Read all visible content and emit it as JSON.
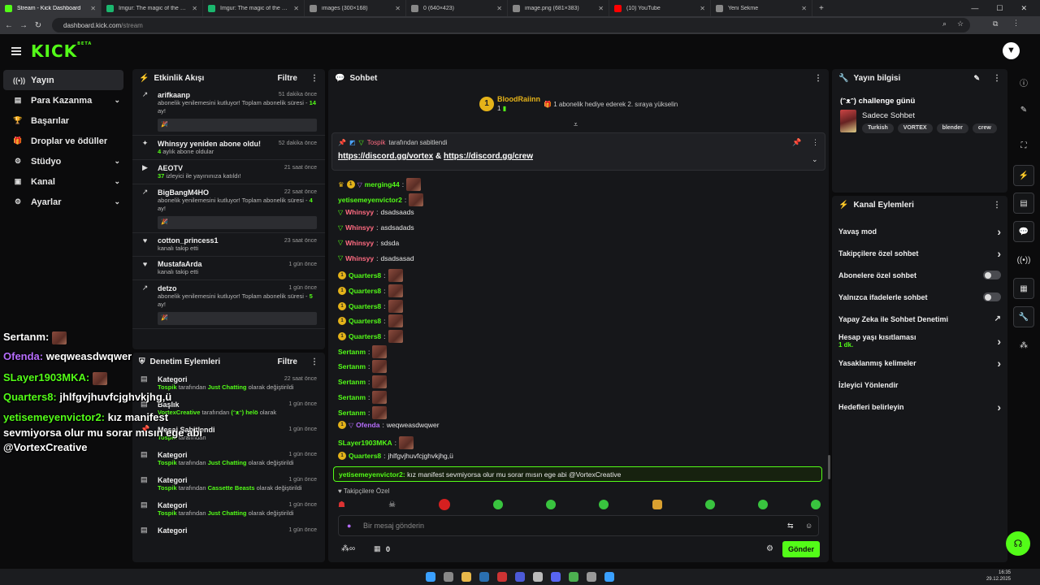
{
  "browser": {
    "tabs": [
      {
        "title": "Stream - Kick Dashboard",
        "color": "#53fc18",
        "active": true
      },
      {
        "title": "Imgur: The magic of the Interne",
        "color": "#1bb76e"
      },
      {
        "title": "Imgur: The magic of the Interne",
        "color": "#1bb76e"
      },
      {
        "title": "images (300×168)",
        "color": "#888888"
      },
      {
        "title": "0 (640×423)",
        "color": "#888888"
      },
      {
        "title": "image.png (681×383)",
        "color": "#888888"
      },
      {
        "title": "(10) YouTube",
        "color": "#ff0000"
      },
      {
        "title": "Yeni Sekme",
        "color": "#888888"
      }
    ],
    "url_host": "dashboard.kick.com",
    "url_path": "/stream"
  },
  "brand": {
    "logo": "KICK",
    "beta": "BETA"
  },
  "sidebar": {
    "items": [
      {
        "label": "Yayın",
        "icon": "broadcast-icon",
        "glyph": "((•))",
        "active": true
      },
      {
        "label": "Para Kazanma",
        "icon": "money-icon",
        "glyph": "▤",
        "chevron": true
      },
      {
        "label": "Başarılar",
        "icon": "trophy-icon",
        "glyph": "🏆"
      },
      {
        "label": "Droplar ve ödüller",
        "icon": "gift-icon",
        "glyph": "🎁"
      },
      {
        "label": "Stüdyo",
        "icon": "gear-icon",
        "glyph": "⚙",
        "chevron": true
      },
      {
        "label": "Kanal",
        "icon": "channel-icon",
        "glyph": "▣",
        "chevron": true
      },
      {
        "label": "Ayarlar",
        "icon": "settings-icon",
        "glyph": "⚙",
        "chevron": true
      }
    ]
  },
  "activity": {
    "title": "Etkinlik Akışı",
    "filter": "Filtre",
    "items": [
      {
        "name": "arifkaanp",
        "time": "51 dakika önce",
        "icon": "resub-icon",
        "glyph": "↗",
        "desc": "abonelik yenilemesini kutluyor! Toplam abonelik süresi - ",
        "bold": "14",
        "tail": " ay!",
        "quote": true
      },
      {
        "name": "Whinsyy yeniden abone oldu!",
        "time": "52 dakika önce",
        "icon": "star-icon",
        "glyph": "✦",
        "desc": "",
        "bold": "4",
        "tail": " aylık abone oldular"
      },
      {
        "name": "AEOTV",
        "time": "21 saat önce",
        "icon": "host-icon",
        "glyph": "▶",
        "desc": "",
        "bold": "37",
        "tail": " izleyici ile yayınınıza katıldı!"
      },
      {
        "name": "BigBangM4HO",
        "time": "22 saat önce",
        "icon": "resub-icon",
        "glyph": "↗",
        "desc": "abonelik yenilemesini kutluyor! Toplam abonelik süresi - ",
        "bold": "4",
        "tail": " ay!",
        "quote": true
      },
      {
        "name": "cotton_princess1",
        "time": "23 saat önce",
        "icon": "heart-icon",
        "glyph": "♥",
        "desc": "kanalı takip etti",
        "bold": "",
        "tail": ""
      },
      {
        "name": "MustafaArda",
        "time": "1 gün önce",
        "icon": "heart-icon",
        "glyph": "♥",
        "desc": "kanalı takip etti",
        "bold": "",
        "tail": ""
      },
      {
        "name": "detzo",
        "time": "1 gün önce",
        "icon": "resub-icon",
        "glyph": "↗",
        "desc": "abonelik yenilemesini kutluyor! Toplam abonelik süresi - ",
        "bold": "5",
        "tail": " ay!",
        "quote": true
      }
    ]
  },
  "modlog": {
    "title": "Denetim Eylemleri",
    "filter": "Filtre",
    "items": [
      {
        "name": "Kategori",
        "time": "22 saat önce",
        "glyph": "▤",
        "user": "Tospik",
        "mid": " tarafından ",
        "target": "Just Chatting",
        "tail": " olarak değiştirildi"
      },
      {
        "name": "Başlık",
        "time": "1 gün önce",
        "glyph": "▤",
        "user": "VortexCreative",
        "mid": " tarafından ",
        "target": "(ᵔᴥᵔ) helö",
        "tail": " olarak"
      },
      {
        "name": "Mesaj Sabitlendi",
        "time": "1 gün önce",
        "glyph": "📌",
        "user": "Tospik",
        "mid": " tarafından",
        "target": "",
        "tail": ""
      },
      {
        "name": "Kategori",
        "time": "1 gün önce",
        "glyph": "▤",
        "user": "Tospik",
        "mid": " tarafından ",
        "target": "Just Chatting",
        "tail": " olarak değiştirildi"
      },
      {
        "name": "Kategori",
        "time": "1 gün önce",
        "glyph": "▤",
        "user": "Tospik",
        "mid": " tarafından ",
        "target": "Cassette Beasts",
        "tail": " olarak değiştirildi"
      },
      {
        "name": "Kategori",
        "time": "1 gün önce",
        "glyph": "▤",
        "user": "Tospik",
        "mid": " tarafından ",
        "target": "Just Chatting",
        "tail": " olarak değiştirildi"
      },
      {
        "name": "Kategori",
        "time": "1 gün önce",
        "glyph": "▤",
        "user": "",
        "mid": "",
        "target": "",
        "tail": ""
      }
    ]
  },
  "chat": {
    "title": "Sohbet",
    "gift": {
      "user": "BloodRaiinn",
      "count": "1",
      "text": "1 abonelik hediye ederek 2. sıraya yükselin"
    },
    "pinned": {
      "by": "Tospik",
      "by_suffix": "tarafından sabitlendi",
      "link1": "https://discord.gg/vortex",
      "amp": " & ",
      "link2": "https://discord.gg/crew"
    },
    "messages": [
      {
        "user": "merging44",
        "color": "#53fc18",
        "text": "",
        "emote": true,
        "badges": [
          "crown",
          "sub",
          "vip"
        ]
      },
      {
        "user": "yetisemeyenvictor2",
        "color": "#53fc18",
        "text": "",
        "emote": true,
        "badges": []
      },
      {
        "user": "Whinsyy",
        "color": "#ff6b81",
        "text": "dsadsaads",
        "badges": [
          "mod"
        ]
      },
      {
        "user": "Whinsyy",
        "color": "#ff6b81",
        "text": "asdsadads",
        "badges": [
          "mod"
        ]
      },
      {
        "user": "Whinsyy",
        "color": "#ff6b81",
        "text": "sdsda",
        "badges": [
          "mod"
        ]
      },
      {
        "user": "Whinsyy",
        "color": "#ff6b81",
        "text": "dsadsasad",
        "badges": [
          "mod"
        ]
      },
      {
        "user": "Quarters8",
        "color": "#53fc18",
        "text": "",
        "emote": true,
        "badges": [
          "sub"
        ]
      },
      {
        "user": "Quarters8",
        "color": "#53fc18",
        "text": "",
        "emote": true,
        "badges": [
          "sub"
        ]
      },
      {
        "user": "Quarters8",
        "color": "#53fc18",
        "text": "",
        "emote": true,
        "badges": [
          "sub"
        ]
      },
      {
        "user": "Quarters8",
        "color": "#53fc18",
        "text": "",
        "emote": true,
        "badges": [
          "sub"
        ]
      },
      {
        "user": "Quarters8",
        "color": "#53fc18",
        "text": "",
        "emote": true,
        "badges": [
          "sub"
        ]
      },
      {
        "user": "Sertanm",
        "color": "#53fc18",
        "text": "",
        "emote": true,
        "badges": []
      },
      {
        "user": "Sertanm",
        "color": "#53fc18",
        "text": "",
        "emote": true,
        "badges": []
      },
      {
        "user": "Sertanm",
        "color": "#53fc18",
        "text": "",
        "emote": true,
        "badges": []
      },
      {
        "user": "Sertanm",
        "color": "#53fc18",
        "text": "",
        "emote": true,
        "badges": []
      },
      {
        "user": "Sertanm",
        "color": "#53fc18",
        "text": "",
        "emote": true,
        "badges": []
      },
      {
        "user": "Ofenda",
        "color": "#b66dfc",
        "text": "weqweasdwqwer",
        "badges": [
          "sub",
          "vip"
        ]
      },
      {
        "user": "SLayer1903MKA",
        "color": "#53fc18",
        "text": "",
        "emote": true,
        "badges": []
      },
      {
        "user": "Quarters8",
        "color": "#53fc18",
        "text": "jhlfgvjhuvfcjghvkjhg,ü",
        "badges": [
          "sub"
        ]
      }
    ],
    "highlight": {
      "user": "yetisemeyenvictor2",
      "text": "kız manifest sevmiyorsa olur mu sorar mısın ege abi @VortexCreative"
    },
    "followers_only": "Takipçilere Özel",
    "input_placeholder": "Bir mesaj gönderin",
    "points": "0",
    "send": "Gönder"
  },
  "stream_info": {
    "title": "Yayın bilgisi",
    "stream_title": "(ᵔᴥᵔ) challenge günü",
    "category": "Sadece Sohbet",
    "tags": [
      "Turkish",
      "VORTEX",
      "blender",
      "crew"
    ]
  },
  "channel_actions": {
    "title": "Kanal Eylemleri",
    "items": [
      {
        "label": "Yavaş mod",
        "kind": "chevron"
      },
      {
        "label": "Takipçilere özel sohbet",
        "kind": "chevron"
      },
      {
        "label": "Abonelere özel sohbet",
        "kind": "toggle"
      },
      {
        "label": "Yalnızca ifadelerle sohbet",
        "kind": "toggle"
      },
      {
        "label": "Yapay Zeka ile Sohbet Denetimi",
        "kind": "external"
      },
      {
        "label": "Hesap yaşı kısıtlaması",
        "sub": "1 dk.",
        "kind": "chevron"
      },
      {
        "label": "Yasaklanmış kelimeler",
        "kind": "chevron"
      },
      {
        "label": "İzleyici Yönlendir",
        "kind": "none"
      },
      {
        "label": "Hedefleri belirleyin",
        "kind": "chevron"
      }
    ]
  },
  "overlay": [
    {
      "user": "Sertanm:",
      "text": "",
      "color": "#ffffff",
      "emote": true
    },
    {
      "user": "Ofenda:",
      "text": "weqweasdwqwer",
      "color": "#b66dfc"
    },
    {
      "user": "SLayer1903MKA:",
      "text": "",
      "color": "#53fc18",
      "emote": true
    },
    {
      "user": "Quarters8:",
      "text": "jhlfgvjhuvfcjghvkjhg,ü",
      "color": "#53fc18"
    },
    {
      "user": "yetisemeyenvictor2:",
      "text": "kız manifest",
      "color": "#53fc18"
    },
    {
      "user": "",
      "text": "sevmiyorsa olur mu sorar mısın ege abi",
      "color": "#ffffff"
    },
    {
      "user": "",
      "text": "@VortexCreative",
      "color": "#ffffff"
    }
  ],
  "clock": {
    "time": "16:35",
    "date": "29.12.2025"
  },
  "colors": {
    "accent": "#53fc18",
    "panel": "#16171a",
    "bg": "#0b0b0c"
  }
}
